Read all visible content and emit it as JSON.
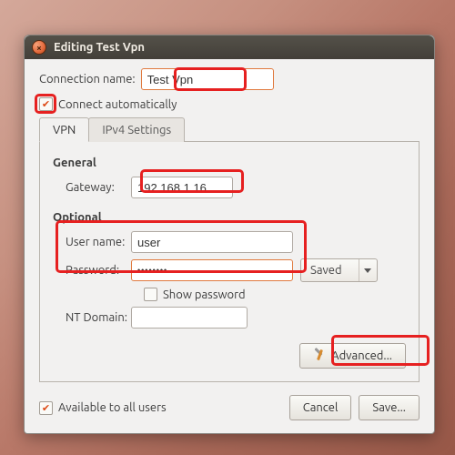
{
  "window": {
    "title": "Editing Test Vpn"
  },
  "connection": {
    "name_label": "Connection name:",
    "name_value": "Test Vpn",
    "connect_auto_label": "Connect automatically"
  },
  "tabs": {
    "vpn": "VPN",
    "ipv4": "IPv4 Settings"
  },
  "general": {
    "heading": "General",
    "gateway_label": "Gateway:",
    "gateway_value": "192.168.1.16"
  },
  "optional": {
    "heading": "Optional",
    "username_label": "User name:",
    "username_value": "user",
    "password_label": "Password:",
    "password_value": "••••••••",
    "password_mode": "Saved",
    "show_password_label": "Show password",
    "nt_domain_label": "NT Domain:",
    "nt_domain_value": ""
  },
  "buttons": {
    "advanced": "Advanced...",
    "cancel": "Cancel",
    "save": "Save..."
  },
  "footer": {
    "available_all_label": "Available to all users"
  }
}
